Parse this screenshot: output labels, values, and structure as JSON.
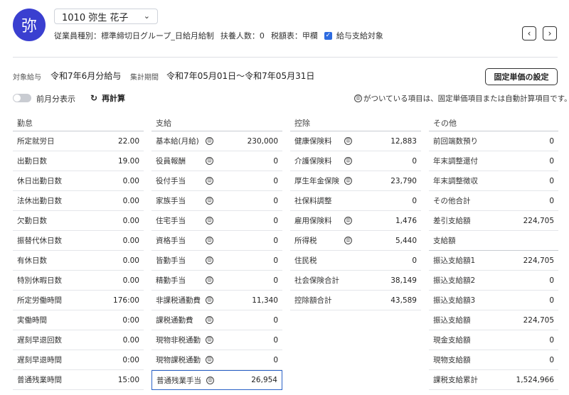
{
  "header": {
    "avatar_char": "弥",
    "employee_name": "1010 弥生 花子",
    "type_label": "従業員種別：標準締切日グループ_日給月給制",
    "dependents_label": "扶養人数：0",
    "tax_table_label": "税額表：甲欄",
    "payment_target_label": "給与支給対象",
    "prev_button": "‹",
    "next_button": "›"
  },
  "period": {
    "target_label": "対象給与",
    "target_value": "令和7年6月分給与",
    "range_label": "集計期間",
    "range_value": "令和7年05月01日〜令和7年05月31日",
    "fixed_button": "固定単価の設定"
  },
  "toolbar": {
    "toggle_label": "前月分表示",
    "recalc_label": "再計算",
    "fx_mark": "㊐",
    "note": "がついている項目は、固定単価項目または自動計算項目です。"
  },
  "columns": {
    "attendance": {
      "title": "勤怠",
      "rows": [
        {
          "label": "所定就労日",
          "value": "22.00"
        },
        {
          "label": "出勤日数",
          "value": "19.00"
        },
        {
          "label": "休日出勤日数",
          "value": "0.00"
        },
        {
          "label": "法休出勤日数",
          "value": "0.00"
        },
        {
          "label": "欠勤日数",
          "value": "0.00"
        },
        {
          "label": "振替代休日数",
          "value": "0.00"
        },
        {
          "label": "有休日数",
          "value": "0.00"
        },
        {
          "label": "特別休暇日数",
          "value": "0.00"
        },
        {
          "label": "所定労働時間",
          "value": "176:00"
        },
        {
          "label": "実働時間",
          "value": "0:00"
        },
        {
          "label": "遅刻早退回数",
          "value": "0.00"
        },
        {
          "label": "遅刻早退時間",
          "value": "0:00"
        },
        {
          "label": "普通残業時間",
          "value": "15:00"
        }
      ]
    },
    "payment": {
      "title": "支給",
      "rows": [
        {
          "label": "基本給(月給)",
          "value": "230,000"
        },
        {
          "label": "役員報酬",
          "value": "0"
        },
        {
          "label": "役付手当",
          "value": "0"
        },
        {
          "label": "家族手当",
          "value": "0"
        },
        {
          "label": "住宅手当",
          "value": "0"
        },
        {
          "label": "資格手当",
          "value": "0"
        },
        {
          "label": "皆勤手当",
          "value": "0"
        },
        {
          "label": "精勤手当",
          "value": "0"
        },
        {
          "label": "非課税通勤費",
          "value": "11,340"
        },
        {
          "label": "課税通勤費",
          "value": "0"
        },
        {
          "label": "現物非税通勤",
          "value": "0"
        },
        {
          "label": "現物課税通勤",
          "value": "0"
        },
        {
          "label": "普通残業手当",
          "value": "26,954"
        }
      ]
    },
    "deduction": {
      "title": "控除",
      "rows": [
        {
          "label": "健康保険料",
          "value": "12,883"
        },
        {
          "label": "介護保険料",
          "value": "0"
        },
        {
          "label": "厚生年金保険",
          "value": "23,790"
        },
        {
          "label": "社保料調整",
          "value": "0"
        },
        {
          "label": "雇用保険料",
          "value": "1,476"
        },
        {
          "label": "所得税",
          "value": "5,440"
        },
        {
          "label": "住民税",
          "value": "0"
        },
        {
          "label": "社会保険合計",
          "value": "38,149"
        },
        {
          "label": "控除額合計",
          "value": "43,589"
        }
      ]
    },
    "other": {
      "title": "その他",
      "rows": [
        {
          "label": "前回端数預り",
          "value": "0"
        },
        {
          "label": "年末調整還付",
          "value": "0"
        },
        {
          "label": "年末調整徴収",
          "value": "0"
        },
        {
          "label": "その他合計",
          "value": "0"
        },
        {
          "label": "差引支給額",
          "value": "224,705"
        },
        {
          "label": "支給額",
          "value": ""
        },
        {
          "label": "振込支給額1",
          "value": "224,705"
        },
        {
          "label": "振込支給額2",
          "value": "0"
        },
        {
          "label": "振込支給額3",
          "value": "0"
        },
        {
          "label": "振込支給額",
          "value": "224,705"
        },
        {
          "label": "現金支給額",
          "value": "0"
        },
        {
          "label": "現物支給額",
          "value": "0"
        },
        {
          "label": "課税支給累計",
          "value": "1,524,966"
        }
      ]
    }
  },
  "colors": {
    "avatar": "#3a3fd0",
    "checkbox": "#2d6be0",
    "highlight_border": "#2b62c7"
  }
}
